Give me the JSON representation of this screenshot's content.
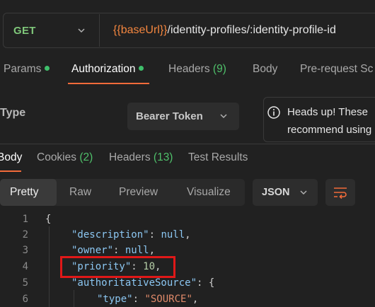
{
  "request": {
    "method": "GET",
    "url_var": "{{baseUrl}}",
    "url_path": "/identity-profiles/:identity-profile-id"
  },
  "request_tabs": [
    {
      "label": "Params",
      "dot": true
    },
    {
      "label": "Authorization",
      "dot": true,
      "active": true
    },
    {
      "label": "Headers",
      "count": "(9)"
    },
    {
      "label": "Body"
    },
    {
      "label": "Pre-request Sc"
    }
  ],
  "auth": {
    "type_label": "Type",
    "type_value": "Bearer Token",
    "notice_title": "Heads up! These",
    "notice_body": "recommend using"
  },
  "response_tabs": [
    {
      "label": "Body",
      "active": true
    },
    {
      "label": "Cookies",
      "count": "(2)"
    },
    {
      "label": "Headers",
      "count": "(13)"
    },
    {
      "label": "Test Results"
    }
  ],
  "view_modes": [
    "Pretty",
    "Raw",
    "Preview",
    "Visualize"
  ],
  "format": "JSON",
  "code": {
    "line_numbers": [
      "1",
      "2",
      "3",
      "4",
      "5",
      "6"
    ],
    "brace_open": "{",
    "lines": [
      {
        "key": "\"description\"",
        "sep": ": ",
        "value": "null",
        "tail": ","
      },
      {
        "key": "\"owner\"",
        "sep": ": ",
        "value": "null",
        "tail": ","
      },
      {
        "key": "\"priority\"",
        "sep": ": ",
        "value": "10",
        "tail": ","
      },
      {
        "key": "\"authoritativeSource\"",
        "sep": ": ",
        "value": "{",
        "tail": ""
      },
      {
        "key": "\"type\"",
        "sep": ": ",
        "value": "\"SOURCE\"",
        "tail": ","
      }
    ]
  },
  "colors": {
    "accent": "#f26b3a",
    "method_get": "#7fc77a",
    "url_variable": "#f3863f",
    "json_key": "#8cc7f2",
    "json_string": "#e08a6a",
    "highlight_box": "#e01818"
  }
}
